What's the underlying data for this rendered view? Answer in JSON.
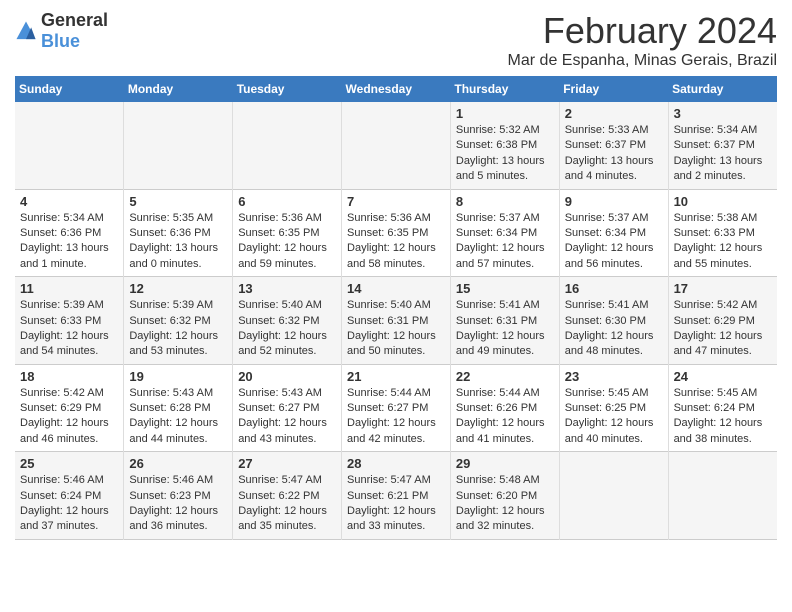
{
  "header": {
    "logo_general": "General",
    "logo_blue": "Blue",
    "title": "February 2024",
    "subtitle": "Mar de Espanha, Minas Gerais, Brazil"
  },
  "weekdays": [
    "Sunday",
    "Monday",
    "Tuesday",
    "Wednesday",
    "Thursday",
    "Friday",
    "Saturday"
  ],
  "weeks": [
    [
      {
        "day": "",
        "info": ""
      },
      {
        "day": "",
        "info": ""
      },
      {
        "day": "",
        "info": ""
      },
      {
        "day": "",
        "info": ""
      },
      {
        "day": "1",
        "info": "Sunrise: 5:32 AM\nSunset: 6:38 PM\nDaylight: 13 hours and 5 minutes."
      },
      {
        "day": "2",
        "info": "Sunrise: 5:33 AM\nSunset: 6:37 PM\nDaylight: 13 hours and 4 minutes."
      },
      {
        "day": "3",
        "info": "Sunrise: 5:34 AM\nSunset: 6:37 PM\nDaylight: 13 hours and 2 minutes."
      }
    ],
    [
      {
        "day": "4",
        "info": "Sunrise: 5:34 AM\nSunset: 6:36 PM\nDaylight: 13 hours and 1 minute."
      },
      {
        "day": "5",
        "info": "Sunrise: 5:35 AM\nSunset: 6:36 PM\nDaylight: 13 hours and 0 minutes."
      },
      {
        "day": "6",
        "info": "Sunrise: 5:36 AM\nSunset: 6:35 PM\nDaylight: 12 hours and 59 minutes."
      },
      {
        "day": "7",
        "info": "Sunrise: 5:36 AM\nSunset: 6:35 PM\nDaylight: 12 hours and 58 minutes."
      },
      {
        "day": "8",
        "info": "Sunrise: 5:37 AM\nSunset: 6:34 PM\nDaylight: 12 hours and 57 minutes."
      },
      {
        "day": "9",
        "info": "Sunrise: 5:37 AM\nSunset: 6:34 PM\nDaylight: 12 hours and 56 minutes."
      },
      {
        "day": "10",
        "info": "Sunrise: 5:38 AM\nSunset: 6:33 PM\nDaylight: 12 hours and 55 minutes."
      }
    ],
    [
      {
        "day": "11",
        "info": "Sunrise: 5:39 AM\nSunset: 6:33 PM\nDaylight: 12 hours and 54 minutes."
      },
      {
        "day": "12",
        "info": "Sunrise: 5:39 AM\nSunset: 6:32 PM\nDaylight: 12 hours and 53 minutes."
      },
      {
        "day": "13",
        "info": "Sunrise: 5:40 AM\nSunset: 6:32 PM\nDaylight: 12 hours and 52 minutes."
      },
      {
        "day": "14",
        "info": "Sunrise: 5:40 AM\nSunset: 6:31 PM\nDaylight: 12 hours and 50 minutes."
      },
      {
        "day": "15",
        "info": "Sunrise: 5:41 AM\nSunset: 6:31 PM\nDaylight: 12 hours and 49 minutes."
      },
      {
        "day": "16",
        "info": "Sunrise: 5:41 AM\nSunset: 6:30 PM\nDaylight: 12 hours and 48 minutes."
      },
      {
        "day": "17",
        "info": "Sunrise: 5:42 AM\nSunset: 6:29 PM\nDaylight: 12 hours and 47 minutes."
      }
    ],
    [
      {
        "day": "18",
        "info": "Sunrise: 5:42 AM\nSunset: 6:29 PM\nDaylight: 12 hours and 46 minutes."
      },
      {
        "day": "19",
        "info": "Sunrise: 5:43 AM\nSunset: 6:28 PM\nDaylight: 12 hours and 44 minutes."
      },
      {
        "day": "20",
        "info": "Sunrise: 5:43 AM\nSunset: 6:27 PM\nDaylight: 12 hours and 43 minutes."
      },
      {
        "day": "21",
        "info": "Sunrise: 5:44 AM\nSunset: 6:27 PM\nDaylight: 12 hours and 42 minutes."
      },
      {
        "day": "22",
        "info": "Sunrise: 5:44 AM\nSunset: 6:26 PM\nDaylight: 12 hours and 41 minutes."
      },
      {
        "day": "23",
        "info": "Sunrise: 5:45 AM\nSunset: 6:25 PM\nDaylight: 12 hours and 40 minutes."
      },
      {
        "day": "24",
        "info": "Sunrise: 5:45 AM\nSunset: 6:24 PM\nDaylight: 12 hours and 38 minutes."
      }
    ],
    [
      {
        "day": "25",
        "info": "Sunrise: 5:46 AM\nSunset: 6:24 PM\nDaylight: 12 hours and 37 minutes."
      },
      {
        "day": "26",
        "info": "Sunrise: 5:46 AM\nSunset: 6:23 PM\nDaylight: 12 hours and 36 minutes."
      },
      {
        "day": "27",
        "info": "Sunrise: 5:47 AM\nSunset: 6:22 PM\nDaylight: 12 hours and 35 minutes."
      },
      {
        "day": "28",
        "info": "Sunrise: 5:47 AM\nSunset: 6:21 PM\nDaylight: 12 hours and 33 minutes."
      },
      {
        "day": "29",
        "info": "Sunrise: 5:48 AM\nSunset: 6:20 PM\nDaylight: 12 hours and 32 minutes."
      },
      {
        "day": "",
        "info": ""
      },
      {
        "day": "",
        "info": ""
      }
    ]
  ]
}
